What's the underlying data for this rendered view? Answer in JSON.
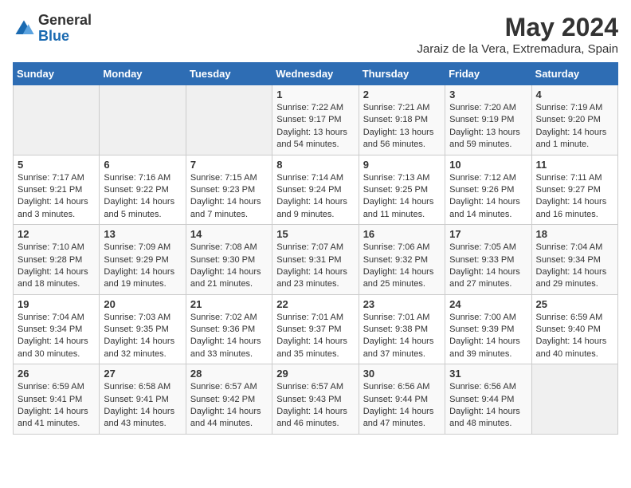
{
  "header": {
    "logo_general": "General",
    "logo_blue": "Blue",
    "month_year": "May 2024",
    "location": "Jaraiz de la Vera, Extremadura, Spain"
  },
  "weekdays": [
    "Sunday",
    "Monday",
    "Tuesday",
    "Wednesday",
    "Thursday",
    "Friday",
    "Saturday"
  ],
  "weeks": [
    [
      {
        "day": "",
        "info": ""
      },
      {
        "day": "",
        "info": ""
      },
      {
        "day": "",
        "info": ""
      },
      {
        "day": "1",
        "info": "Sunrise: 7:22 AM\nSunset: 9:17 PM\nDaylight: 13 hours and 54 minutes."
      },
      {
        "day": "2",
        "info": "Sunrise: 7:21 AM\nSunset: 9:18 PM\nDaylight: 13 hours and 56 minutes."
      },
      {
        "day": "3",
        "info": "Sunrise: 7:20 AM\nSunset: 9:19 PM\nDaylight: 13 hours and 59 minutes."
      },
      {
        "day": "4",
        "info": "Sunrise: 7:19 AM\nSunset: 9:20 PM\nDaylight: 14 hours and 1 minute."
      }
    ],
    [
      {
        "day": "5",
        "info": "Sunrise: 7:17 AM\nSunset: 9:21 PM\nDaylight: 14 hours and 3 minutes."
      },
      {
        "day": "6",
        "info": "Sunrise: 7:16 AM\nSunset: 9:22 PM\nDaylight: 14 hours and 5 minutes."
      },
      {
        "day": "7",
        "info": "Sunrise: 7:15 AM\nSunset: 9:23 PM\nDaylight: 14 hours and 7 minutes."
      },
      {
        "day": "8",
        "info": "Sunrise: 7:14 AM\nSunset: 9:24 PM\nDaylight: 14 hours and 9 minutes."
      },
      {
        "day": "9",
        "info": "Sunrise: 7:13 AM\nSunset: 9:25 PM\nDaylight: 14 hours and 11 minutes."
      },
      {
        "day": "10",
        "info": "Sunrise: 7:12 AM\nSunset: 9:26 PM\nDaylight: 14 hours and 14 minutes."
      },
      {
        "day": "11",
        "info": "Sunrise: 7:11 AM\nSunset: 9:27 PM\nDaylight: 14 hours and 16 minutes."
      }
    ],
    [
      {
        "day": "12",
        "info": "Sunrise: 7:10 AM\nSunset: 9:28 PM\nDaylight: 14 hours and 18 minutes."
      },
      {
        "day": "13",
        "info": "Sunrise: 7:09 AM\nSunset: 9:29 PM\nDaylight: 14 hours and 19 minutes."
      },
      {
        "day": "14",
        "info": "Sunrise: 7:08 AM\nSunset: 9:30 PM\nDaylight: 14 hours and 21 minutes."
      },
      {
        "day": "15",
        "info": "Sunrise: 7:07 AM\nSunset: 9:31 PM\nDaylight: 14 hours and 23 minutes."
      },
      {
        "day": "16",
        "info": "Sunrise: 7:06 AM\nSunset: 9:32 PM\nDaylight: 14 hours and 25 minutes."
      },
      {
        "day": "17",
        "info": "Sunrise: 7:05 AM\nSunset: 9:33 PM\nDaylight: 14 hours and 27 minutes."
      },
      {
        "day": "18",
        "info": "Sunrise: 7:04 AM\nSunset: 9:34 PM\nDaylight: 14 hours and 29 minutes."
      }
    ],
    [
      {
        "day": "19",
        "info": "Sunrise: 7:04 AM\nSunset: 9:34 PM\nDaylight: 14 hours and 30 minutes."
      },
      {
        "day": "20",
        "info": "Sunrise: 7:03 AM\nSunset: 9:35 PM\nDaylight: 14 hours and 32 minutes."
      },
      {
        "day": "21",
        "info": "Sunrise: 7:02 AM\nSunset: 9:36 PM\nDaylight: 14 hours and 33 minutes."
      },
      {
        "day": "22",
        "info": "Sunrise: 7:01 AM\nSunset: 9:37 PM\nDaylight: 14 hours and 35 minutes."
      },
      {
        "day": "23",
        "info": "Sunrise: 7:01 AM\nSunset: 9:38 PM\nDaylight: 14 hours and 37 minutes."
      },
      {
        "day": "24",
        "info": "Sunrise: 7:00 AM\nSunset: 9:39 PM\nDaylight: 14 hours and 39 minutes."
      },
      {
        "day": "25",
        "info": "Sunrise: 6:59 AM\nSunset: 9:40 PM\nDaylight: 14 hours and 40 minutes."
      }
    ],
    [
      {
        "day": "26",
        "info": "Sunrise: 6:59 AM\nSunset: 9:41 PM\nDaylight: 14 hours and 41 minutes."
      },
      {
        "day": "27",
        "info": "Sunrise: 6:58 AM\nSunset: 9:41 PM\nDaylight: 14 hours and 43 minutes."
      },
      {
        "day": "28",
        "info": "Sunrise: 6:57 AM\nSunset: 9:42 PM\nDaylight: 14 hours and 44 minutes."
      },
      {
        "day": "29",
        "info": "Sunrise: 6:57 AM\nSunset: 9:43 PM\nDaylight: 14 hours and 46 minutes."
      },
      {
        "day": "30",
        "info": "Sunrise: 6:56 AM\nSunset: 9:44 PM\nDaylight: 14 hours and 47 minutes."
      },
      {
        "day": "31",
        "info": "Sunrise: 6:56 AM\nSunset: 9:44 PM\nDaylight: 14 hours and 48 minutes."
      },
      {
        "day": "",
        "info": ""
      }
    ]
  ]
}
